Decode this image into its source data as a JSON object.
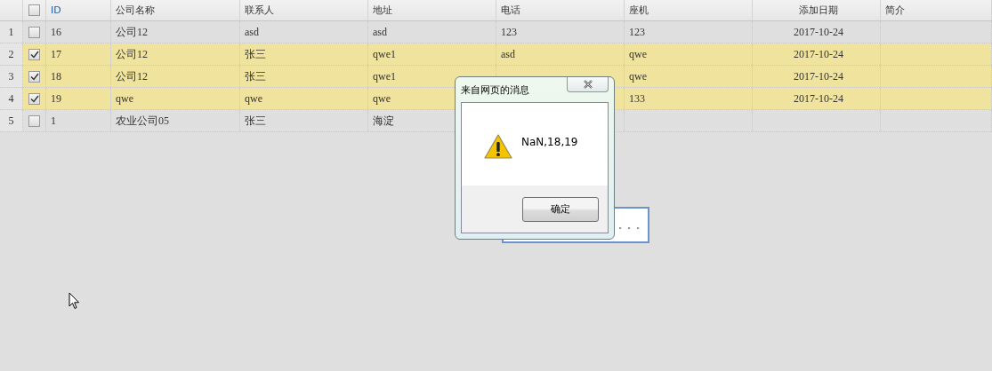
{
  "table": {
    "select_all": {
      "checked": false
    },
    "columns": [
      "ID",
      "公司名称",
      "联系人",
      "地址",
      "电话",
      "座机",
      "添加日期",
      "简介"
    ],
    "rows": [
      {
        "number": "1",
        "checked": false,
        "cells": [
          "16",
          "公司12",
          "asd",
          "asd",
          "123",
          "123",
          "2017-10-24"
        ]
      },
      {
        "number": "2",
        "checked": true,
        "cells": [
          "17",
          "公司12",
          "张三",
          "qwe1",
          "asd",
          "qwe",
          "2017-10-24"
        ]
      },
      {
        "number": "3",
        "checked": true,
        "cells": [
          "18",
          "公司12",
          "张三",
          "qwe1",
          null,
          "qwe",
          "2017-10-24"
        ]
      },
      {
        "number": "4",
        "checked": true,
        "cells": [
          "19",
          "qwe",
          "qwe",
          "qwe",
          null,
          "133",
          "2017-10-24"
        ]
      },
      {
        "number": "5",
        "checked": false,
        "cells": [
          "1",
          "农业公司05",
          "张三",
          "海淀"
        ]
      }
    ]
  },
  "loading": {
    "text": "。。。"
  },
  "dialog": {
    "title": "来自网页的消息",
    "message": "NaN,18,19",
    "button": "确定"
  }
}
